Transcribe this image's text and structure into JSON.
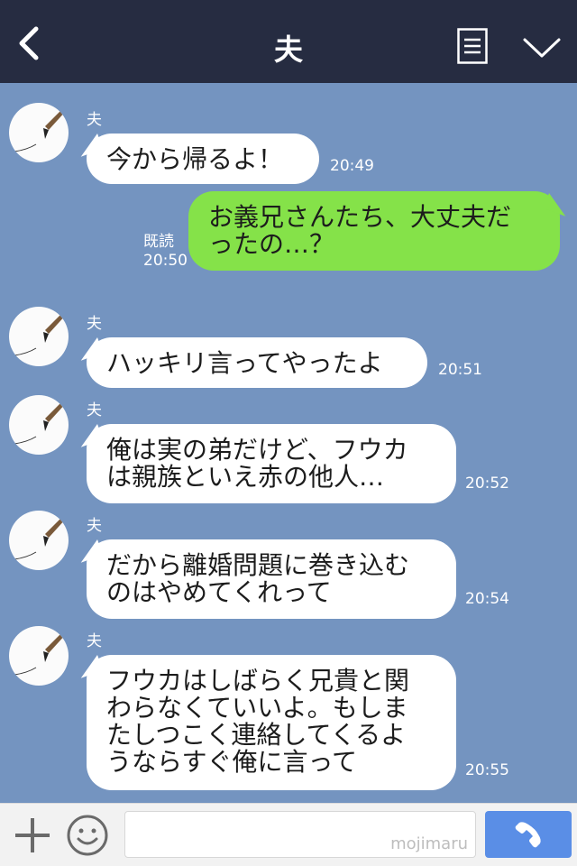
{
  "header": {
    "title": "夫",
    "back_icon": "chevron-left-icon",
    "notes_icon": "notes-icon",
    "menu_icon": "chevron-down-icon"
  },
  "messages": [
    {
      "sender": "夫",
      "text": "今から帰るよ！",
      "time": "20:49"
    },
    {
      "read": "既読",
      "text": "お義兄さんたち、大丈夫だ\nったの…？",
      "time": "20:50"
    },
    {
      "sender": "夫",
      "text": "ハッキリ言ってやったよ",
      "time": "20:51"
    },
    {
      "sender": "夫",
      "text": "俺は実の弟だけど、フウカ\nは親族といえ赤の他人…",
      "time": "20:52"
    },
    {
      "sender": "夫",
      "text": "だから離婚問題に巻き込む\nのはやめてくれって",
      "time": "20:54"
    },
    {
      "sender": "夫",
      "text": "フウカはしばらく兄貴と関\nわらなくていいよ。もしま\nたしつこく連絡してくるよ\nうならすぐ俺に言って",
      "time": "20:55"
    }
  ],
  "footer": {
    "input_value": "",
    "watermark": "mojimaru",
    "plus_icon": "plus-icon",
    "emoji_icon": "smiley-icon",
    "call_icon": "phone-icon"
  },
  "colors": {
    "header_bg": "#262c41",
    "chat_bg": "#7494c0",
    "outgoing_bubble": "#85e249",
    "incoming_bubble": "#ffffff",
    "call_button": "#5a8ee6"
  }
}
